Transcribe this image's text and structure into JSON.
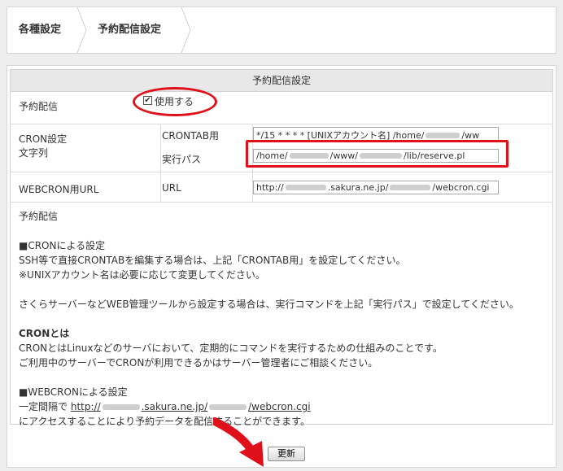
{
  "breadcrumb": {
    "home": "各種設定",
    "current": "予約配信設定"
  },
  "panel": {
    "title": "予約配信設定"
  },
  "rows": {
    "reserve": {
      "label": "予約配信",
      "checkbox_label": "使用する",
      "checked": true
    },
    "cron": {
      "label_line1": "CRON設定",
      "label_line2": "文字列",
      "crontab_label": "CRONTAB用",
      "crontab_value": "*/15 * * * * [UNIXアカウント名] /home/",
      "crontab_value_tail": "/ww",
      "path_label": "実行パス",
      "path_value_a": "/home/",
      "path_value_b": "/www/",
      "path_value_c": "/lib/reserve.pl"
    },
    "webcron": {
      "label": "WEBCRON用URL",
      "url_label": "URL",
      "url_value_a": "http://",
      "url_value_b": ".sakura.ne.jp/",
      "url_value_c": "/webcron.cgi"
    }
  },
  "description": {
    "heading": "予約配信",
    "cron_title": "■CRONによる設定",
    "cron_line1": "SSH等で直接CRONTABを編集する場合は、上記「CRONTAB用」を設定してください。",
    "cron_line2": "※UNIXアカウント名は必要に応じて変更してください。",
    "sakura_line": "さくらサーバーなどWEB管理ツールから設定する場合は、実行コマンドを上記「実行パス」で設定してください。",
    "what_title": "CRONとは",
    "what_line1": "CRONとはLinuxなどのサーバにおいて、定期的にコマンドを実行するための仕組みのことです。",
    "what_line2": "ご利用中のサーバーでCRONが利用できるかはサーバー管理者にご相談ください。",
    "webcron_title": "■WEBCRONによる設定",
    "webcron_prefix": "一定間隔で",
    "webcron_link_a": "http://",
    "webcron_link_b": ".sakura.ne.jp/",
    "webcron_link_c": "/webcron.cgi",
    "webcron_line2": "にアクセスすることにより予約データを配信することができます。"
  },
  "update_button": "更新",
  "colors": {
    "annotation": "#e0101a"
  }
}
